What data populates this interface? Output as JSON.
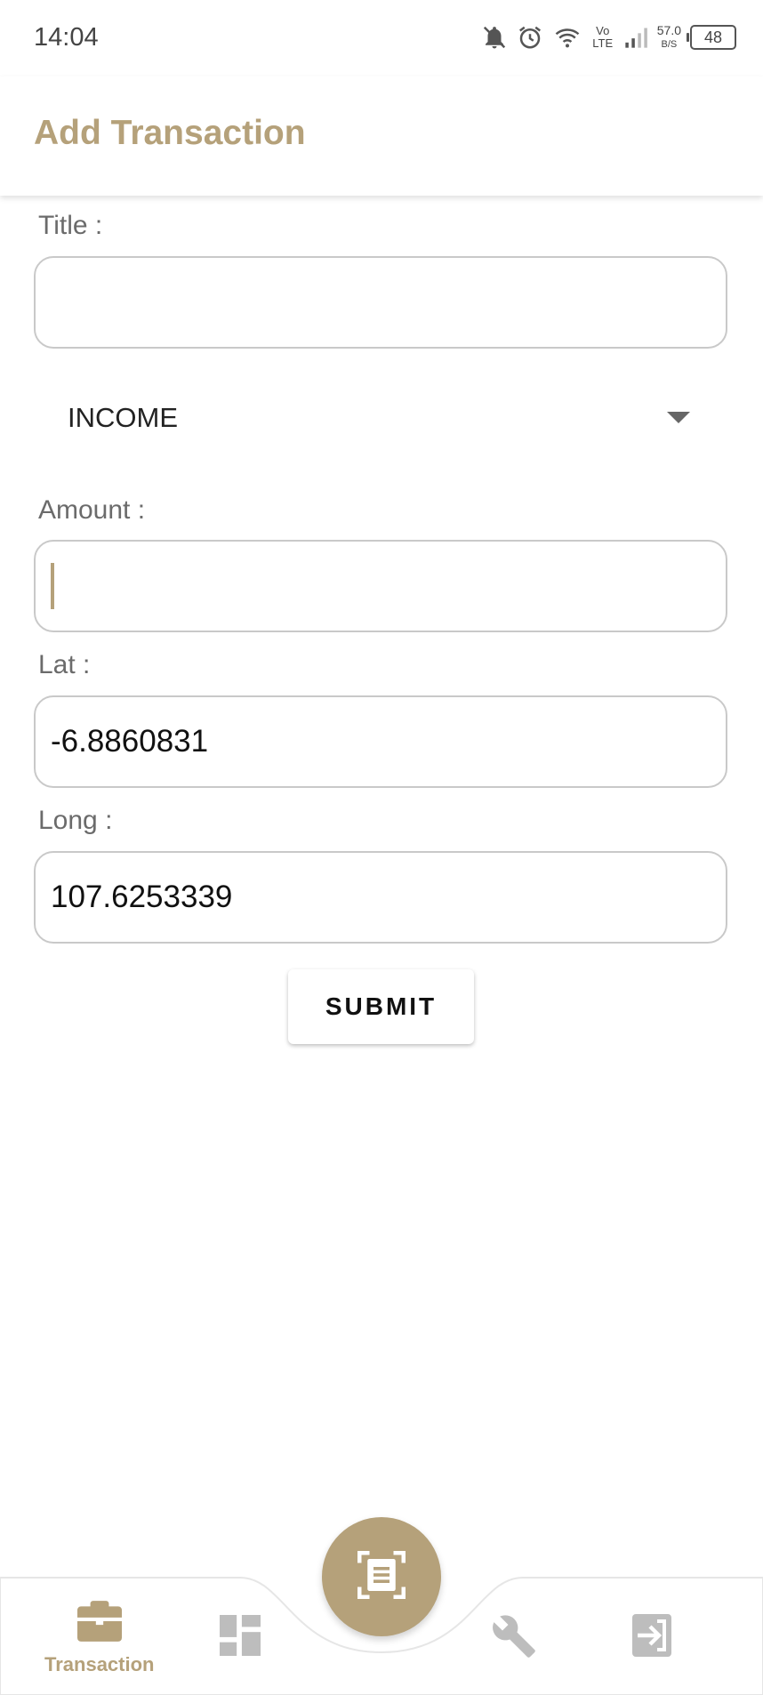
{
  "status_bar": {
    "time": "14:04",
    "network_speed_value": "57.0",
    "network_speed_unit": "B/S",
    "network_type": "Vo LTE",
    "battery_level": "48",
    "icons": [
      "bell-off-icon",
      "alarm-icon",
      "wifi-icon",
      "volte-icon",
      "signal-icon",
      "battery-icon"
    ]
  },
  "app_bar": {
    "title": "Add Transaction"
  },
  "form": {
    "title_label": "Title :",
    "title_value": "",
    "type_selected": "INCOME",
    "amount_label": "Amount :",
    "amount_value": "",
    "lat_label": "Lat :",
    "lat_value": "-6.8860831",
    "long_label": "Long :",
    "long_value": "107.6253339",
    "submit_label": "SUBMIT"
  },
  "bottom_nav": {
    "items": [
      {
        "label": "Transaction",
        "icon": "briefcase-icon",
        "active": true
      },
      {
        "label": "",
        "icon": "dashboard-icon",
        "active": false
      },
      {
        "label": "",
        "icon": "wrench-icon",
        "active": false
      },
      {
        "label": "",
        "icon": "logout-icon",
        "active": false
      }
    ],
    "fab_icon": "scan-document-icon"
  },
  "colors": {
    "accent": "#b5a17a",
    "inactive_icon": "#bdbdbd",
    "field_border": "#c9c9c9"
  }
}
